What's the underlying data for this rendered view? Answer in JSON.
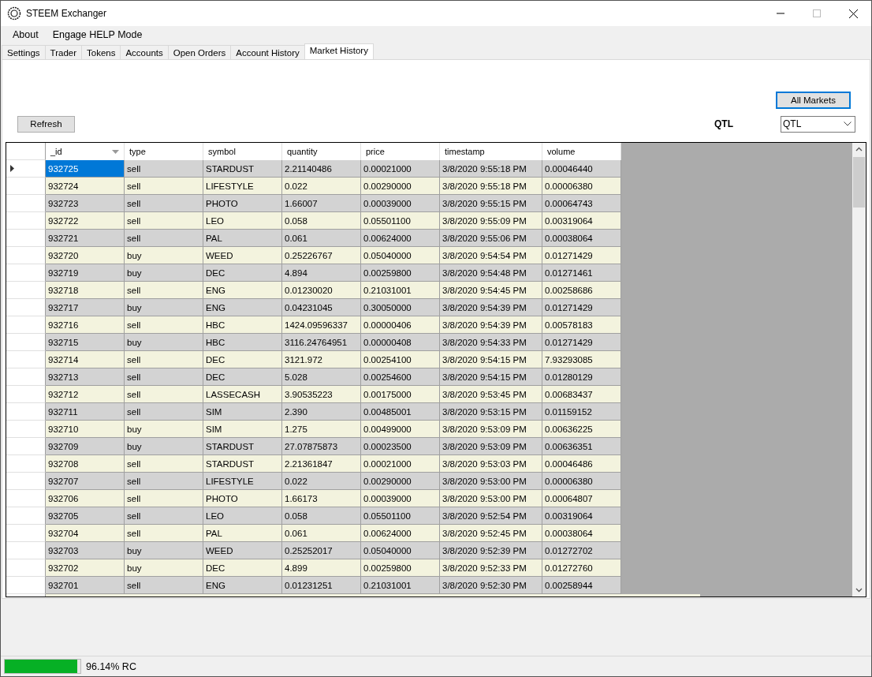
{
  "window": {
    "title": "STEEM Exchanger"
  },
  "menu": [
    "About",
    "Engage HELP Mode"
  ],
  "tabs": [
    {
      "label": "Settings",
      "selected": false
    },
    {
      "label": "Trader",
      "selected": false
    },
    {
      "label": "Tokens",
      "selected": false
    },
    {
      "label": "Accounts",
      "selected": false
    },
    {
      "label": "Open Orders",
      "selected": false
    },
    {
      "label": "Account History",
      "selected": false
    },
    {
      "label": "Market History",
      "selected": true
    }
  ],
  "all_markets_button": "All Markets",
  "refresh_button": "Refresh",
  "market_label": "QTL",
  "market_select": {
    "value": "QTL"
  },
  "table": {
    "columns": [
      {
        "label": "_id",
        "sorted": true
      },
      {
        "label": "type",
        "sorted": false
      },
      {
        "label": "symbol",
        "sorted": false
      },
      {
        "label": "quantity",
        "sorted": false
      },
      {
        "label": "price",
        "sorted": false
      },
      {
        "label": "timestamp",
        "sorted": false
      },
      {
        "label": "volume",
        "sorted": false
      }
    ],
    "rows": [
      {
        "selected": true,
        "cells": [
          "932725",
          "sell",
          "STARDUST",
          "2.21140486",
          "0.00021000",
          "3/8/2020 9:55:18 PM",
          "0.00046440"
        ]
      },
      {
        "selected": false,
        "cells": [
          "932724",
          "sell",
          "LIFESTYLE",
          "0.022",
          "0.00290000",
          "3/8/2020 9:55:18 PM",
          "0.00006380"
        ]
      },
      {
        "selected": false,
        "cells": [
          "932723",
          "sell",
          "PHOTO",
          "1.66007",
          "0.00039000",
          "3/8/2020 9:55:15 PM",
          "0.00064743"
        ]
      },
      {
        "selected": false,
        "cells": [
          "932722",
          "sell",
          "LEO",
          "0.058",
          "0.05501100",
          "3/8/2020 9:55:09 PM",
          "0.00319064"
        ]
      },
      {
        "selected": false,
        "cells": [
          "932721",
          "sell",
          "PAL",
          "0.061",
          "0.00624000",
          "3/8/2020 9:55:06 PM",
          "0.00038064"
        ]
      },
      {
        "selected": false,
        "cells": [
          "932720",
          "buy",
          "WEED",
          "0.25226767",
          "0.05040000",
          "3/8/2020 9:54:54 PM",
          "0.01271429"
        ]
      },
      {
        "selected": false,
        "cells": [
          "932719",
          "buy",
          "DEC",
          "4.894",
          "0.00259800",
          "3/8/2020 9:54:48 PM",
          "0.01271461"
        ]
      },
      {
        "selected": false,
        "cells": [
          "932718",
          "sell",
          "ENG",
          "0.01230020",
          "0.21031001",
          "3/8/2020 9:54:45 PM",
          "0.00258686"
        ]
      },
      {
        "selected": false,
        "cells": [
          "932717",
          "buy",
          "ENG",
          "0.04231045",
          "0.30050000",
          "3/8/2020 9:54:39 PM",
          "0.01271429"
        ]
      },
      {
        "selected": false,
        "cells": [
          "932716",
          "sell",
          "HBC",
          "1424.09596337",
          "0.00000406",
          "3/8/2020 9:54:39 PM",
          "0.00578183"
        ]
      },
      {
        "selected": false,
        "cells": [
          "932715",
          "buy",
          "HBC",
          "3116.24764951",
          "0.00000408",
          "3/8/2020 9:54:33 PM",
          "0.01271429"
        ]
      },
      {
        "selected": false,
        "cells": [
          "932714",
          "sell",
          "DEC",
          "3121.972",
          "0.00254100",
          "3/8/2020 9:54:15 PM",
          "7.93293085"
        ]
      },
      {
        "selected": false,
        "cells": [
          "932713",
          "sell",
          "DEC",
          "5.028",
          "0.00254600",
          "3/8/2020 9:54:15 PM",
          "0.01280129"
        ]
      },
      {
        "selected": false,
        "cells": [
          "932712",
          "sell",
          "LASSECASH",
          "3.90535223",
          "0.00175000",
          "3/8/2020 9:53:45 PM",
          "0.00683437"
        ]
      },
      {
        "selected": false,
        "cells": [
          "932711",
          "sell",
          "SIM",
          "2.390",
          "0.00485001",
          "3/8/2020 9:53:15 PM",
          "0.01159152"
        ]
      },
      {
        "selected": false,
        "cells": [
          "932710",
          "buy",
          "SIM",
          "1.275",
          "0.00499000",
          "3/8/2020 9:53:09 PM",
          "0.00636225"
        ]
      },
      {
        "selected": false,
        "cells": [
          "932709",
          "buy",
          "STARDUST",
          "27.07875873",
          "0.00023500",
          "3/8/2020 9:53:09 PM",
          "0.00636351"
        ]
      },
      {
        "selected": false,
        "cells": [
          "932708",
          "sell",
          "STARDUST",
          "2.21361847",
          "0.00021000",
          "3/8/2020 9:53:03 PM",
          "0.00046486"
        ]
      },
      {
        "selected": false,
        "cells": [
          "932707",
          "sell",
          "LIFESTYLE",
          "0.022",
          "0.00290000",
          "3/8/2020 9:53:00 PM",
          "0.00006380"
        ]
      },
      {
        "selected": false,
        "cells": [
          "932706",
          "sell",
          "PHOTO",
          "1.66173",
          "0.00039000",
          "3/8/2020 9:53:00 PM",
          "0.00064807"
        ]
      },
      {
        "selected": false,
        "cells": [
          "932705",
          "sell",
          "LEO",
          "0.058",
          "0.05501100",
          "3/8/2020 9:52:54 PM",
          "0.00319064"
        ]
      },
      {
        "selected": false,
        "cells": [
          "932704",
          "sell",
          "PAL",
          "0.061",
          "0.00624000",
          "3/8/2020 9:52:45 PM",
          "0.00038064"
        ]
      },
      {
        "selected": false,
        "cells": [
          "932703",
          "buy",
          "WEED",
          "0.25252017",
          "0.05040000",
          "3/8/2020 9:52:39 PM",
          "0.01272702"
        ]
      },
      {
        "selected": false,
        "cells": [
          "932702",
          "buy",
          "DEC",
          "4.899",
          "0.00259800",
          "3/8/2020 9:52:33 PM",
          "0.01272760"
        ]
      },
      {
        "selected": false,
        "cells": [
          "932701",
          "sell",
          "ENG",
          "0.01231251",
          "0.21031001",
          "3/8/2020 9:52:30 PM",
          "0.00258944"
        ]
      }
    ]
  },
  "status_bar": {
    "rc": {
      "level": 0.9614
    },
    "text": "96.14% RC"
  }
}
